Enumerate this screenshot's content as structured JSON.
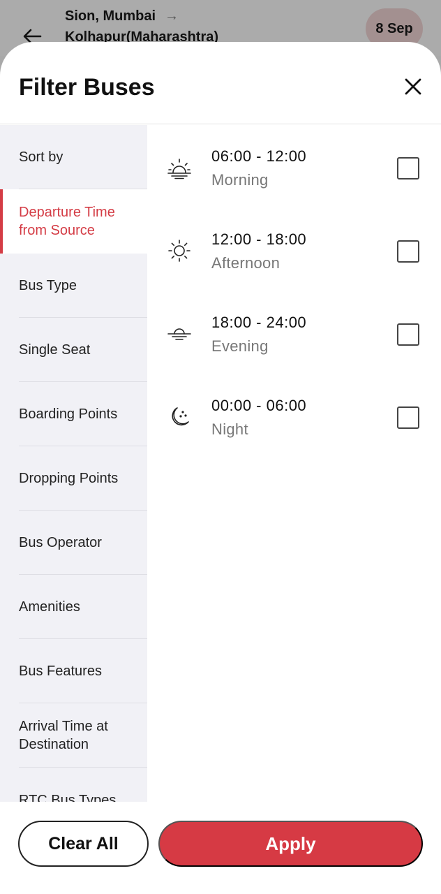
{
  "background_header": {
    "route_from": "Sion, Mumbai",
    "route_arrow": "→",
    "route_to": "Kolhapur(Maharashtra)",
    "date": "8 Sep",
    "back_icon": "arrow-left-icon"
  },
  "sheet": {
    "title": "Filter Buses",
    "close_icon": "close-icon"
  },
  "nav": {
    "active_index": 1,
    "items": [
      {
        "label": "Sort by"
      },
      {
        "label": "Departure Time from Source"
      },
      {
        "label": "Bus Type"
      },
      {
        "label": "Single Seat"
      },
      {
        "label": "Boarding Points"
      },
      {
        "label": "Dropping Points"
      },
      {
        "label": "Bus Operator"
      },
      {
        "label": "Amenities"
      },
      {
        "label": "Bus Features"
      },
      {
        "label": "Arrival Time at Destination"
      },
      {
        "label": "RTC Bus Types"
      }
    ]
  },
  "options": [
    {
      "range": "06:00 - 12:00",
      "name": "Morning",
      "icon": "sunrise-icon",
      "checked": false
    },
    {
      "range": "12:00 - 18:00",
      "name": "Afternoon",
      "icon": "sun-icon",
      "checked": false
    },
    {
      "range": "18:00 - 24:00",
      "name": "Evening",
      "icon": "sunset-icon",
      "checked": false
    },
    {
      "range": "00:00 - 06:00",
      "name": "Night",
      "icon": "moon-icon",
      "checked": false
    }
  ],
  "footer": {
    "clear_label": "Clear All",
    "apply_label": "Apply"
  },
  "colors": {
    "accent": "#d63a44",
    "nav_bg": "#f1f1f6",
    "overlay": "#ababab"
  }
}
